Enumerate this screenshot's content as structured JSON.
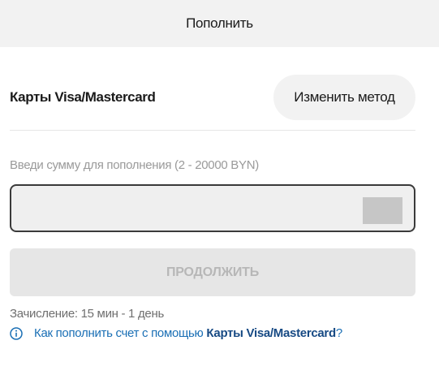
{
  "header": {
    "title": "Пополнить"
  },
  "method": {
    "name": "Карты Visa/Mastercard",
    "change_label": "Изменить метод"
  },
  "amount": {
    "label": "Введи сумму для пополнения (2 - 20000 BYN)",
    "value": ""
  },
  "continue_label": "ПРОДОЛЖИТЬ",
  "credit_time": "Зачисление: 15 мин - 1 день",
  "help": {
    "prefix": "Как пополнить счет с помощью ",
    "link": "Карты Visa/Mastercard",
    "suffix": "?",
    "icon": "info-icon"
  },
  "colors": {
    "link": "#1a6fb5",
    "link_strong": "#174a84",
    "disabled_button": "#e6e6e6",
    "input_border": "#3a3a3a"
  }
}
